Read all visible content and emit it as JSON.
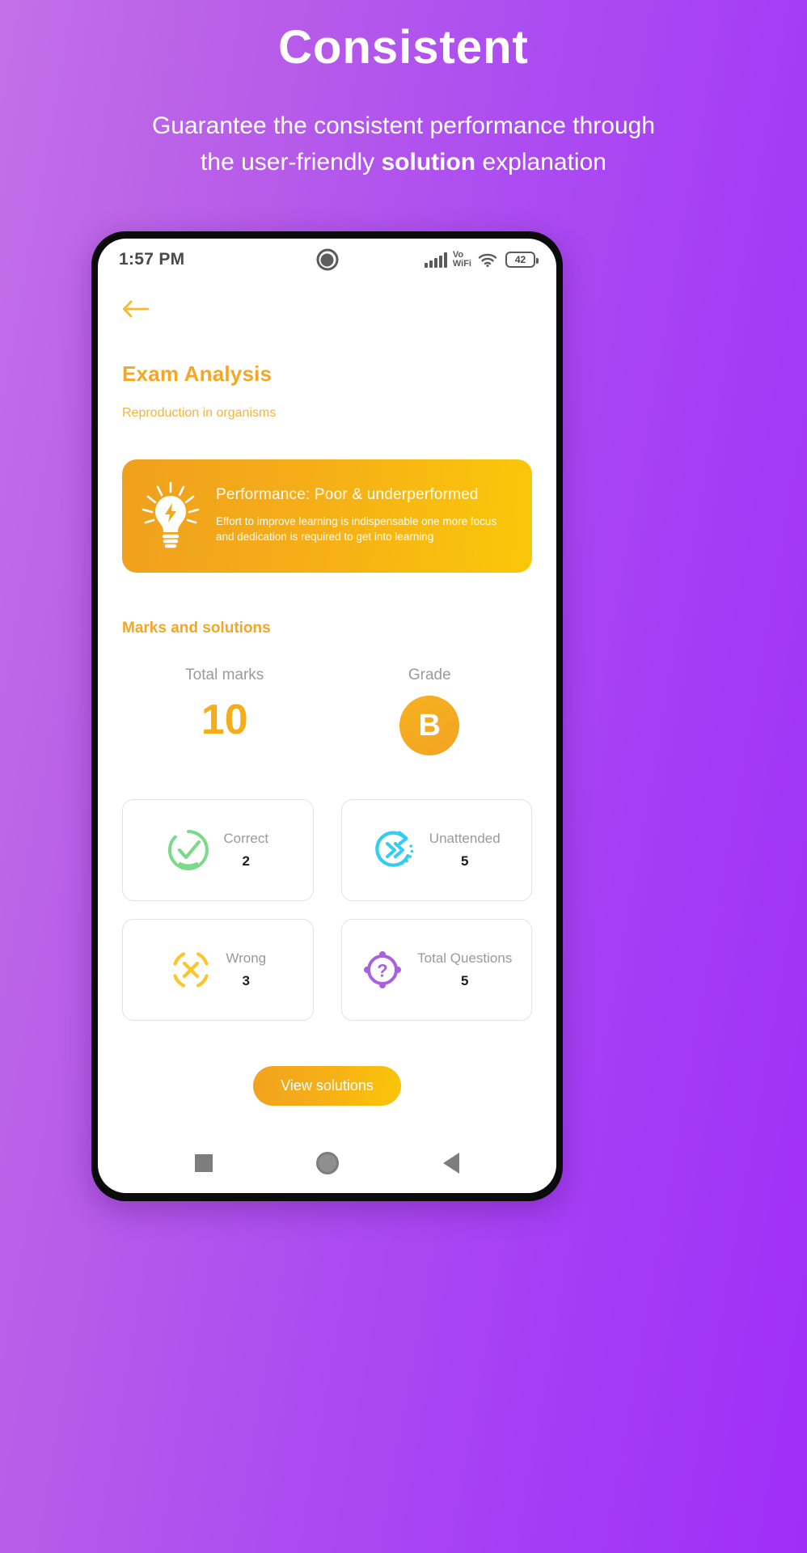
{
  "promo": {
    "title": "Consistent",
    "subtitle_part1": "Guarantee the consistent performance through\nthe user-friendly ",
    "subtitle_bold": "solution",
    "subtitle_part2": " explanation"
  },
  "statusbar": {
    "time": "1:57 PM",
    "vo_label": "Vo",
    "wifi_label": "WiFi",
    "battery_level": "42",
    "signal_icon": "signal-bars-icon",
    "wifi_icon": "wifi-icon",
    "camera_icon": "front-camera-icon",
    "battery_icon": "battery-icon"
  },
  "app": {
    "back_icon": "back-arrow-icon",
    "title": "Exam Analysis",
    "subtitle": "Reproduction in organisms",
    "performance": {
      "icon": "lightbulb-idea-icon",
      "headline": "Performance: Poor & underperformed",
      "description": "Effort to improve learning is indispensable one more focus\nand dedication is required to get into learning"
    },
    "section_title": "Marks and solutions",
    "total_marks_label": "Total marks",
    "total_marks_value": "10",
    "grade_label": "Grade",
    "grade_value": "B",
    "stats": [
      {
        "label": "Correct",
        "value": "2",
        "icon": "check-circle-icon",
        "color": "#7ada89"
      },
      {
        "label": "Unattended",
        "value": "5",
        "icon": "double-chevron-circle-icon",
        "color": "#33cdf4"
      },
      {
        "label": "Wrong",
        "value": "3",
        "icon": "x-circle-icon",
        "color": "#fbc52b"
      },
      {
        "label": "Total Questions",
        "value": "5",
        "icon": "question-circle-icon",
        "color": "#a85fe0"
      }
    ],
    "cta_label": "View solutions"
  },
  "navbar": {
    "recents_icon": "square-recents-icon",
    "home_icon": "circle-home-icon",
    "back_icon": "triangle-back-icon"
  },
  "colors": {
    "brand_orange": "#f5a623",
    "brand_yellow": "#fbc709",
    "background_purple_start": "#c271e8",
    "background_purple_end": "#9f2ef7"
  }
}
